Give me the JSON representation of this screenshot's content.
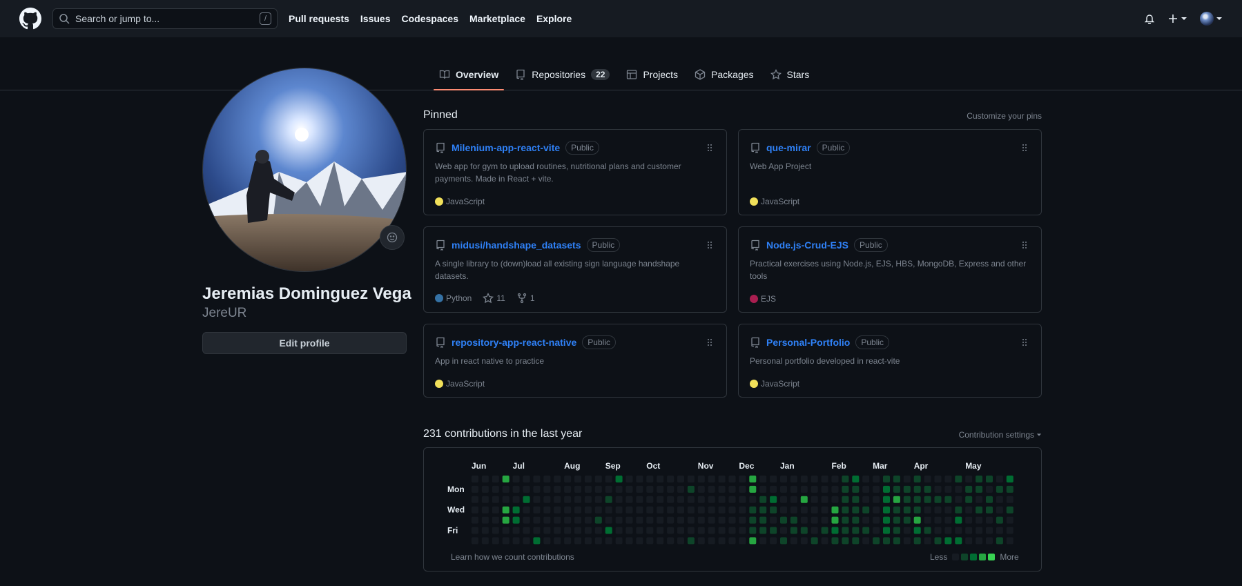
{
  "header": {
    "search_placeholder": "Search or jump to...",
    "search_shortcut": "/",
    "nav": [
      "Pull requests",
      "Issues",
      "Codespaces",
      "Marketplace",
      "Explore"
    ],
    "icons": [
      "github-logo",
      "search-icon",
      "bell-icon",
      "plus-icon",
      "avatar"
    ]
  },
  "tabs": [
    {
      "label": "Overview",
      "icon": "book-icon",
      "active": true
    },
    {
      "label": "Repositories",
      "icon": "repo-icon",
      "count": "22"
    },
    {
      "label": "Projects",
      "icon": "table-icon"
    },
    {
      "label": "Packages",
      "icon": "package-icon"
    },
    {
      "label": "Stars",
      "icon": "star-icon"
    }
  ],
  "profile": {
    "name": "Jeremias Dominguez Vega",
    "login": "JereUR",
    "edit_label": "Edit profile"
  },
  "pinned": {
    "title": "Pinned",
    "customize_label": "Customize your pins",
    "repos": [
      {
        "name": "Milenium-app-react-vite",
        "visibility": "Public",
        "description": "Web app for gym to upload routines, nutritional plans and customer payments. Made in React + vite.",
        "language": "JavaScript",
        "lang_color": "#f1e05a"
      },
      {
        "name": "que-mirar",
        "visibility": "Public",
        "description": "Web App Project",
        "language": "JavaScript",
        "lang_color": "#f1e05a"
      },
      {
        "name": "midusi/handshape_datasets",
        "visibility": "Public",
        "description": "A single library to (down)load all existing sign language handshape datasets.",
        "language": "Python",
        "lang_color": "#3572A5",
        "stars": "11",
        "forks": "1"
      },
      {
        "name": "Node.js-Crud-EJS",
        "visibility": "Public",
        "description": "Practical exercises using Node.js, EJS, HBS, MongoDB, Express and other tools",
        "language": "EJS",
        "lang_color": "#a91e50"
      },
      {
        "name": "repository-app-react-native",
        "visibility": "Public",
        "description": "App in react native to practice",
        "language": "JavaScript",
        "lang_color": "#f1e05a"
      },
      {
        "name": "Personal-Portfolio",
        "visibility": "Public",
        "description": "Personal portfolio developed in react-vite",
        "language": "JavaScript",
        "lang_color": "#f1e05a"
      }
    ]
  },
  "contributions": {
    "title": "231 contributions in the last year",
    "settings_label": "Contribution settings",
    "months": [
      "Jun",
      "Jul",
      "Aug",
      "Sep",
      "Oct",
      "Nov",
      "Dec",
      "Jan",
      "Feb",
      "Mar",
      "Apr",
      "May"
    ],
    "days": [
      "Mon",
      "Wed",
      "Fri"
    ],
    "learn_label": "Learn how we count contributions",
    "less_label": "Less",
    "more_label": "More",
    "level_colors": [
      "#161b22",
      "#0e4429",
      "#006d32",
      "#26a641",
      "#39d353"
    ],
    "grid_weeks": 53,
    "active_cells": [
      [
        3,
        0,
        3
      ],
      [
        3,
        3,
        3
      ],
      [
        3,
        4,
        3
      ],
      [
        4,
        3,
        2
      ],
      [
        4,
        4,
        2
      ],
      [
        5,
        2,
        2
      ],
      [
        6,
        6,
        2
      ],
      [
        14,
        0,
        2
      ],
      [
        13,
        2,
        1
      ],
      [
        12,
        4,
        1
      ],
      [
        13,
        5,
        2
      ],
      [
        21,
        1,
        1
      ],
      [
        27,
        1,
        1
      ],
      [
        21,
        6,
        1
      ],
      [
        27,
        0,
        3
      ],
      [
        27,
        1,
        3
      ],
      [
        27,
        3,
        1
      ],
      [
        27,
        4,
        1
      ],
      [
        27,
        5,
        1
      ],
      [
        27,
        6,
        3
      ],
      [
        28,
        2,
        1
      ],
      [
        28,
        3,
        1
      ],
      [
        28,
        4,
        1
      ],
      [
        28,
        5,
        1
      ],
      [
        29,
        2,
        2
      ],
      [
        29,
        3,
        1
      ],
      [
        29,
        5,
        1
      ],
      [
        30,
        4,
        1
      ],
      [
        30,
        6,
        1
      ],
      [
        31,
        4,
        1
      ],
      [
        31,
        5,
        1
      ],
      [
        32,
        2,
        3
      ],
      [
        32,
        5,
        1
      ],
      [
        33,
        6,
        1
      ],
      [
        34,
        5,
        1
      ],
      [
        35,
        3,
        3
      ],
      [
        35,
        4,
        3
      ],
      [
        35,
        5,
        2
      ],
      [
        35,
        6,
        1
      ],
      [
        36,
        0,
        1
      ],
      [
        36,
        1,
        1
      ],
      [
        36,
        2,
        1
      ],
      [
        36,
        3,
        1
      ],
      [
        36,
        4,
        1
      ],
      [
        36,
        5,
        1
      ],
      [
        36,
        6,
        1
      ],
      [
        37,
        0,
        2
      ],
      [
        37,
        1,
        1
      ],
      [
        37,
        2,
        1
      ],
      [
        37,
        3,
        1
      ],
      [
        37,
        4,
        1
      ],
      [
        37,
        5,
        1
      ],
      [
        37,
        6,
        1
      ],
      [
        38,
        3,
        1
      ],
      [
        38,
        5,
        1
      ],
      [
        39,
        6,
        1
      ],
      [
        40,
        0,
        1
      ],
      [
        40,
        1,
        2
      ],
      [
        40,
        2,
        2
      ],
      [
        40,
        3,
        2
      ],
      [
        40,
        4,
        2
      ],
      [
        40,
        5,
        2
      ],
      [
        40,
        6,
        1
      ],
      [
        41,
        0,
        1
      ],
      [
        41,
        1,
        1
      ],
      [
        41,
        2,
        3
      ],
      [
        41,
        3,
        1
      ],
      [
        41,
        4,
        1
      ],
      [
        41,
        5,
        1
      ],
      [
        41,
        6,
        1
      ],
      [
        42,
        1,
        1
      ],
      [
        42,
        2,
        1
      ],
      [
        42,
        3,
        1
      ],
      [
        42,
        4,
        1
      ],
      [
        43,
        0,
        1
      ],
      [
        43,
        1,
        1
      ],
      [
        43,
        2,
        1
      ],
      [
        43,
        3,
        1
      ],
      [
        43,
        4,
        3
      ],
      [
        43,
        5,
        2
      ],
      [
        43,
        6,
        1
      ],
      [
        44,
        1,
        1
      ],
      [
        44,
        2,
        1
      ],
      [
        44,
        5,
        1
      ],
      [
        45,
        2,
        1
      ],
      [
        45,
        6,
        1
      ],
      [
        46,
        2,
        1
      ],
      [
        46,
        6,
        2
      ],
      [
        47,
        0,
        1
      ],
      [
        47,
        3,
        1
      ],
      [
        47,
        4,
        2
      ],
      [
        47,
        6,
        2
      ],
      [
        48,
        1,
        1
      ],
      [
        48,
        2,
        1
      ],
      [
        49,
        0,
        1
      ],
      [
        49,
        1,
        1
      ],
      [
        49,
        3,
        1
      ],
      [
        50,
        0,
        1
      ],
      [
        50,
        2,
        1
      ],
      [
        50,
        3,
        1
      ],
      [
        51,
        1,
        1
      ],
      [
        51,
        4,
        1
      ],
      [
        51,
        6,
        1
      ],
      [
        52,
        0,
        2
      ],
      [
        52,
        1,
        1
      ],
      [
        52,
        3,
        1
      ]
    ]
  }
}
